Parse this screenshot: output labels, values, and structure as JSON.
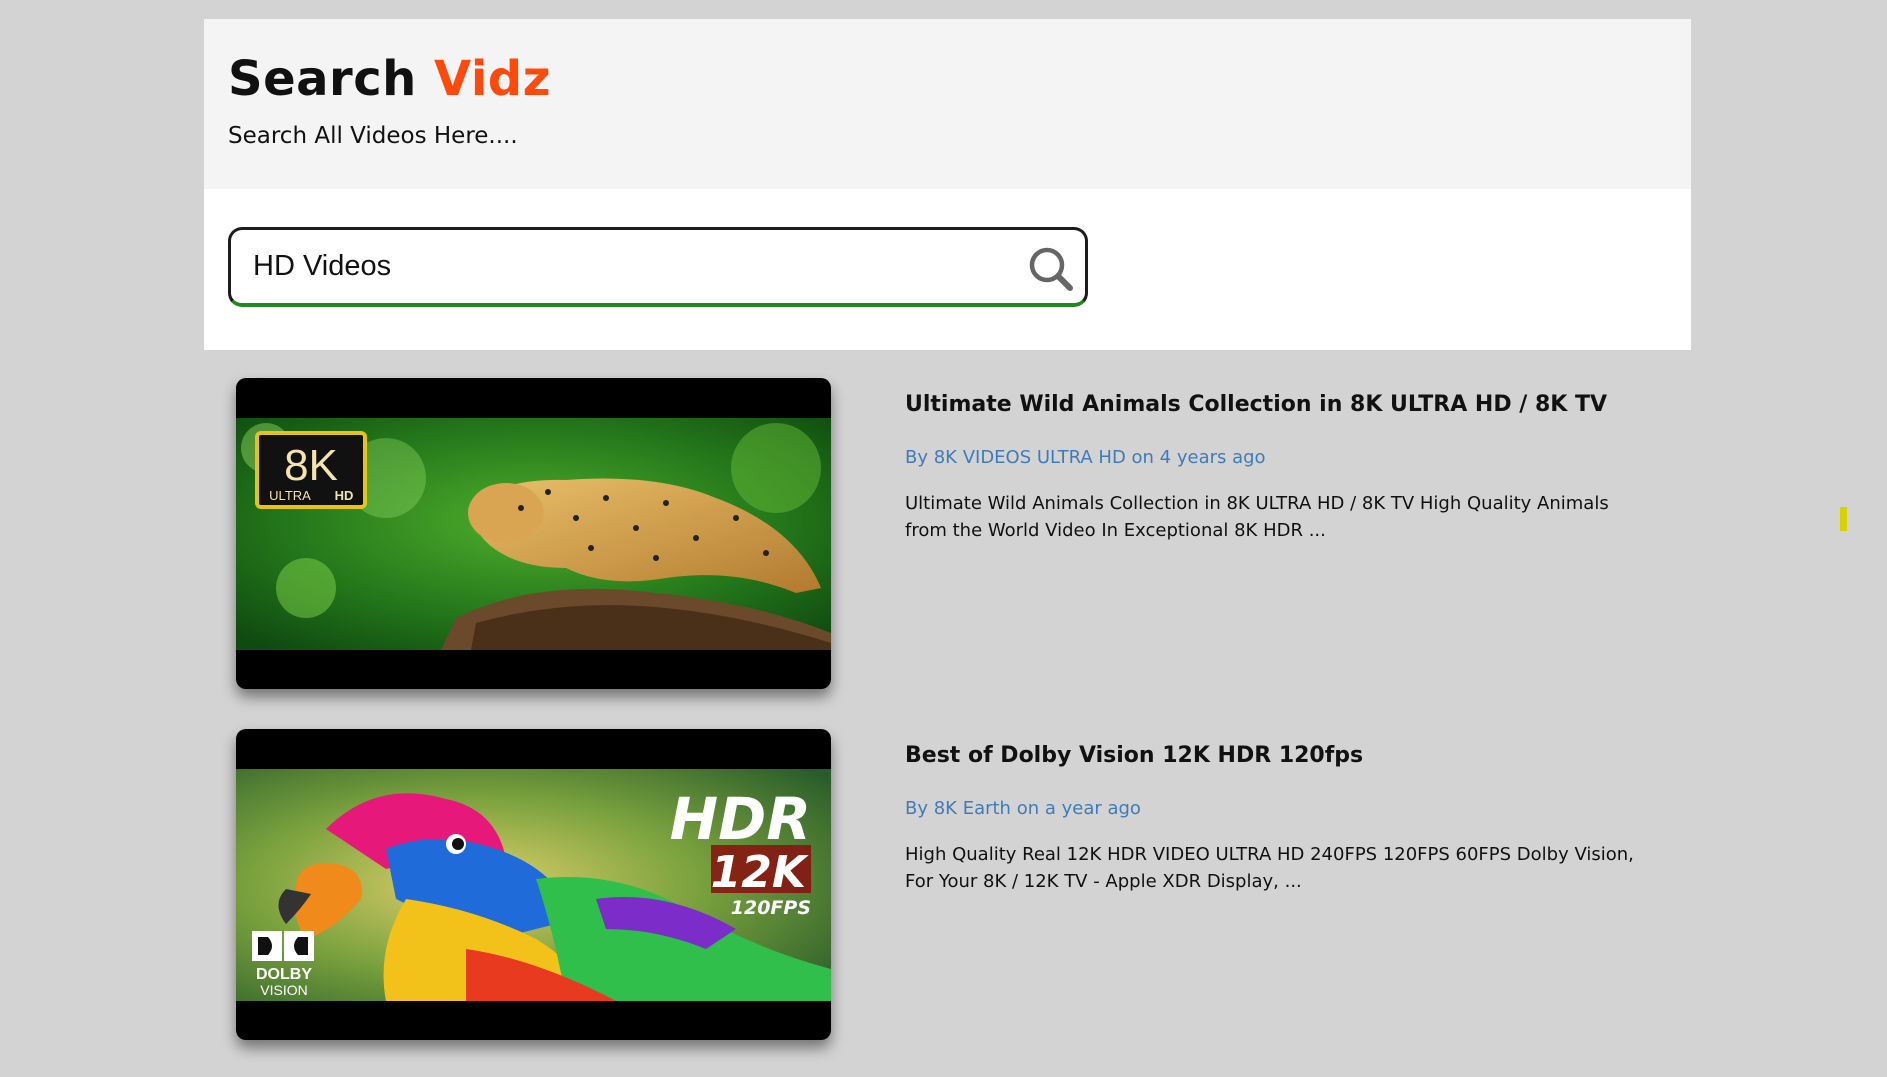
{
  "header": {
    "brand_part1": "Search",
    "brand_part2": "Vidz",
    "tagline": "Search All Videos Here...."
  },
  "search": {
    "value": "HD Videos",
    "icon": "search-icon"
  },
  "results": [
    {
      "title": "Ultimate Wild Animals Collection in 8K ULTRA HD / 8K TV",
      "meta": "By 8K VIDEOS ULTRA HD on 4 years ago",
      "description": "Ultimate Wild Animals Collection in 8K ULTRA HD / 8K TV High Quality Animals from the World Video In Exceptional 8K HDR ...",
      "thumb_badge_main": "8K",
      "thumb_badge_sub1": "ULTRA",
      "thumb_badge_sub2": "HD"
    },
    {
      "title": "Best of Dolby Vision 12K HDR 120fps",
      "meta": "By 8K Earth on a year ago",
      "description": "High Quality Real 12K HDR VIDEO ULTRA HD 240FPS 120FPS 60FPS Dolby Vision, For Your 8K / 12K TV - Apple XDR Display, ...",
      "thumb_text_1": "HDR",
      "thumb_text_2": "12K",
      "thumb_text_3": "120FPS",
      "thumb_logo_1": "DOLBY",
      "thumb_logo_2": "VISION"
    }
  ],
  "colors": {
    "page_bg": "#d3d3d3",
    "brand_accent": "#ff4a0d",
    "meta_link": "#3f7cb7",
    "search_underline": "#1f8a20"
  }
}
